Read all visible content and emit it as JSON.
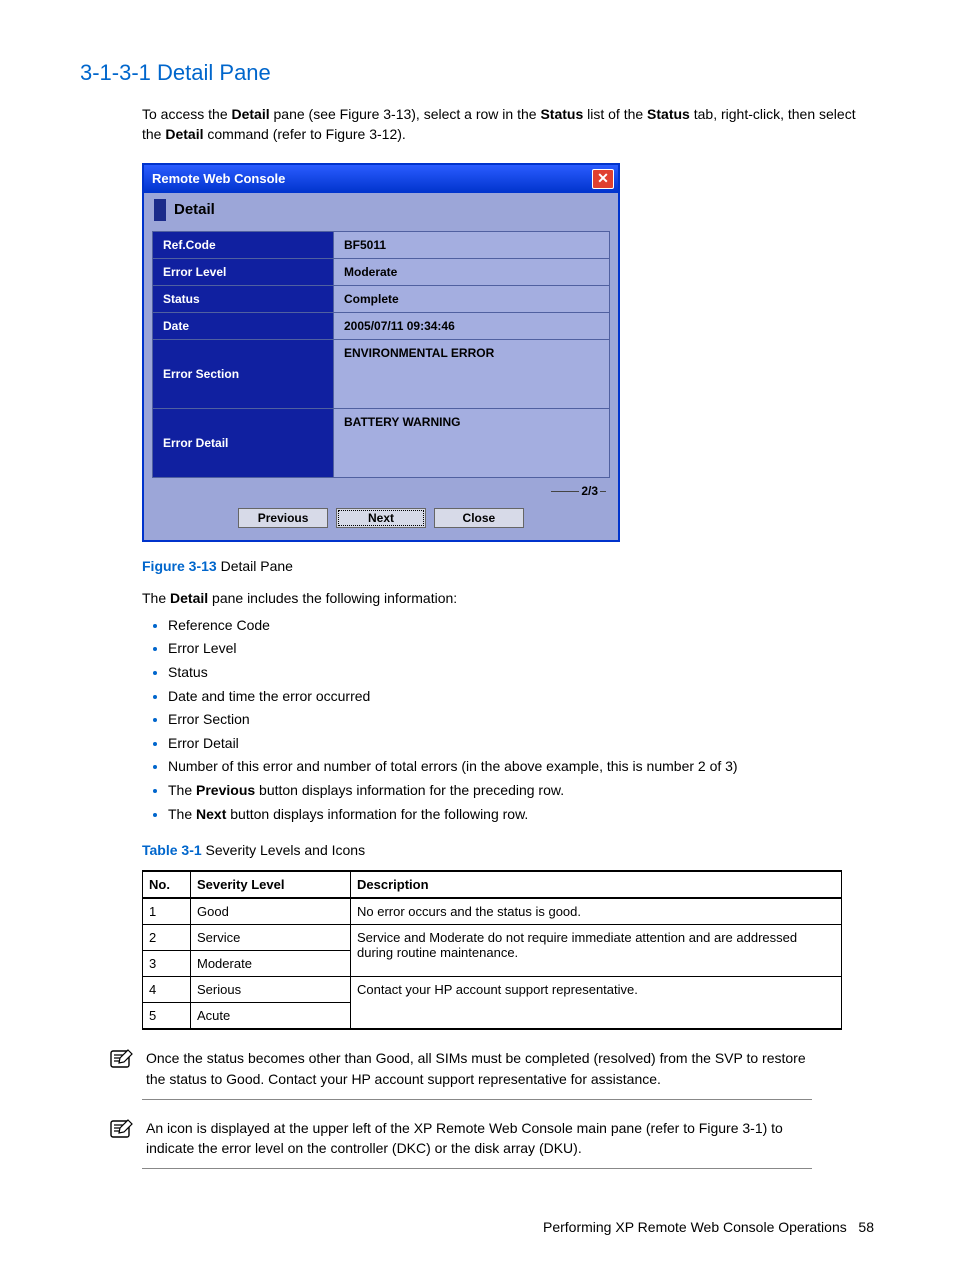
{
  "heading": "3-1-3-1 Detail Pane",
  "intro": {
    "p1a": "To access the ",
    "p1b": "Detail",
    "p1c": " pane (see Figure 3-13), select a row in the ",
    "p1d": "Status",
    "p1e": " list of the ",
    "p1f": "Status",
    "p1g": " tab, right-click, then select the ",
    "p1h": "Detail",
    "p1i": " command (refer to Figure 3-12)."
  },
  "dialog": {
    "title": "Remote Web Console",
    "close": "✕",
    "subheader": "Detail",
    "rows": [
      {
        "label": "Ref.Code",
        "value": "BF5011"
      },
      {
        "label": "Error Level",
        "value": "Moderate"
      },
      {
        "label": "Status",
        "value": "Complete"
      },
      {
        "label": "Date",
        "value": "2005/07/11 09:34:46"
      },
      {
        "label": "Error Section",
        "value": "ENVIRONMENTAL ERROR",
        "tall": true
      },
      {
        "label": "Error Detail",
        "value": "BATTERY WARNING",
        "tall": true
      }
    ],
    "pager": "2/3",
    "buttons": {
      "prev": "Previous",
      "next": "Next",
      "close": "Close"
    }
  },
  "figure": {
    "num": "Figure 3-13",
    "text": "  Detail Pane"
  },
  "afterfig": {
    "a": "The ",
    "b": "Detail",
    "c": " pane includes the following information:"
  },
  "bullets": [
    {
      "text": "Reference Code"
    },
    {
      "text": "Error Level"
    },
    {
      "text": "Status"
    },
    {
      "text": "Date and time the error occurred"
    },
    {
      "text": "Error Section"
    },
    {
      "text": "Error Detail"
    },
    {
      "text": "Number of this error and number of total errors (in the above example, this is number 2 of 3)"
    },
    {
      "pre": "The ",
      "bold": "Previous",
      "post": " button displays information for the preceding row."
    },
    {
      "pre": "The ",
      "bold": "Next",
      "post": " button displays information for the following row."
    }
  ],
  "table": {
    "caption_num": "Table 3-1",
    "caption_text": " Severity Levels and Icons",
    "head": {
      "c1": "No.",
      "c2": "Severity Level",
      "c3": "Description"
    },
    "rows": [
      {
        "no": "1",
        "level": "Good",
        "desc": "No error occurs and the status is good."
      },
      {
        "no": "2",
        "level": "Service",
        "desc": "Service and Moderate do not require immediate attention and are addressed during routine maintenance.",
        "rowspan": 2
      },
      {
        "no": "3",
        "level": "Moderate"
      },
      {
        "no": "4",
        "level": "Serious",
        "desc": "Contact your HP account support representative.",
        "rowspan": 2
      },
      {
        "no": "5",
        "level": "Acute"
      }
    ]
  },
  "note1": "Once the status becomes other than Good, all SIMs must be completed (resolved) from the SVP to restore the status to Good. Contact your HP account support representative for assistance.",
  "note2": "An icon is displayed at the upper left of the XP Remote Web Console main pane (refer to Figure 3-1) to indicate the error level on the controller (DKC) or the disk array (DKU).",
  "footer": {
    "text": "Performing XP Remote Web Console Operations",
    "page": "58"
  }
}
